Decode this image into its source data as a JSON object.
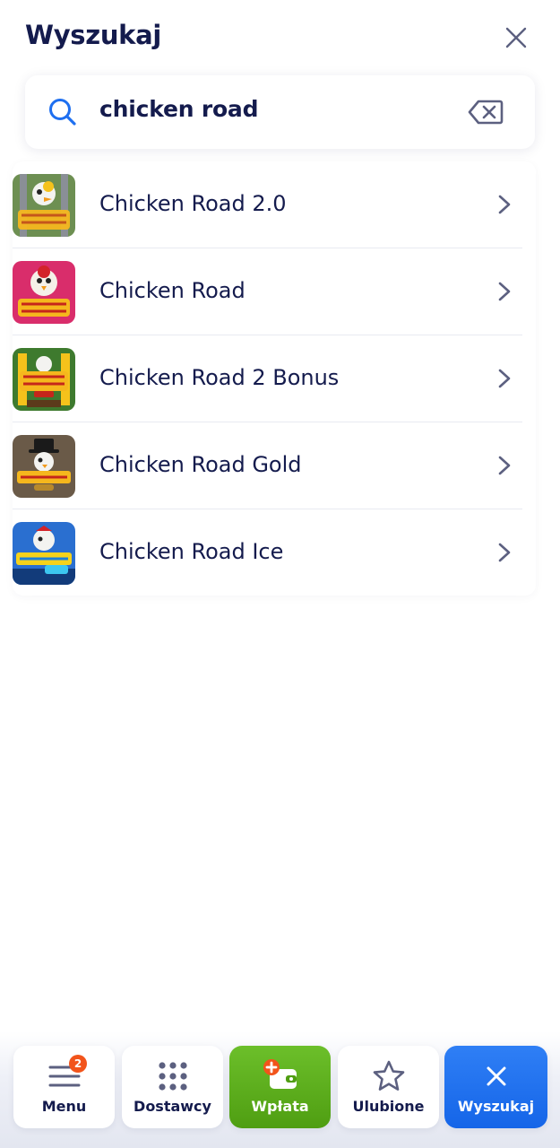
{
  "header": {
    "title": "Wyszukaj",
    "close_icon": "close-icon"
  },
  "search": {
    "value": "chicken road",
    "clear_icon": "backspace-icon",
    "search_icon": "search-icon"
  },
  "results": [
    {
      "label": "Chicken Road 2.0",
      "thumb_bg": "#5c8f3a",
      "thumb_text": "CHICKEN ROAD 2"
    },
    {
      "label": "Chicken Road",
      "thumb_bg": "#d92d6b",
      "thumb_text": "CHICKEN ROAD"
    },
    {
      "label": "Chicken Road 2 Bonus",
      "thumb_bg": "#3e7a2e",
      "thumb_text": "CHICKEN ROAD 2"
    },
    {
      "label": "Chicken Road Gold",
      "thumb_bg": "#6a5a48",
      "thumb_text": "CHICKEN ROAD Gold"
    },
    {
      "label": "Chicken Road Ice",
      "thumb_bg": "#1d5fb8",
      "thumb_text": "CHICKEN ROAD ICE"
    }
  ],
  "bottom_nav": {
    "menu": {
      "label": "Menu",
      "badge": "2",
      "icon": "hamburger-menu-icon"
    },
    "providers": {
      "label": "Dostawcy",
      "icon": "grid-dots-icon"
    },
    "deposit": {
      "label": "Wpłata",
      "icon": "wallet-plus-icon"
    },
    "favorites": {
      "label": "Ulubione",
      "icon": "star-icon"
    },
    "search": {
      "label": "Wyszukaj",
      "icon": "close-icon"
    }
  },
  "colors": {
    "text": "#141b4d",
    "accent_blue": "#1e6ff0",
    "green": "#5aab1c",
    "badge": "#f2541b"
  }
}
